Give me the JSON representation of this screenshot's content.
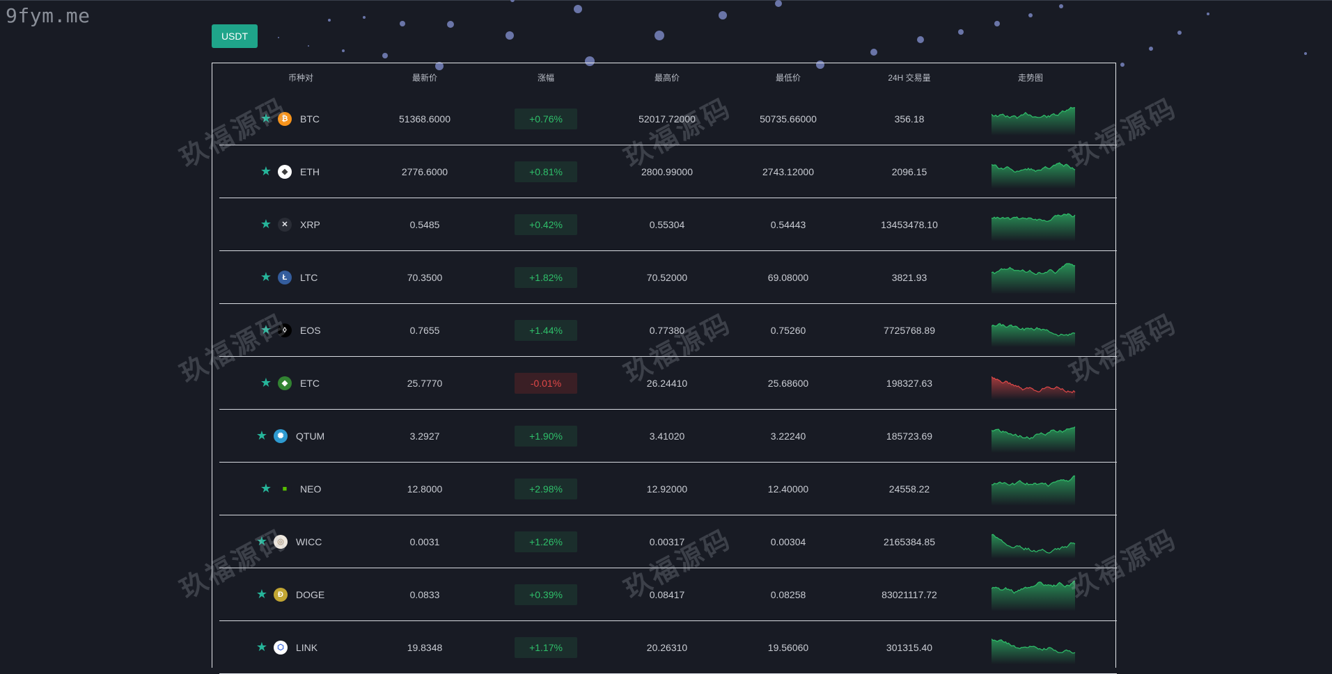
{
  "watermark_site": "9fym.me",
  "watermark_text": "玖福源码",
  "quote_button": "USDT",
  "colors": {
    "up": "#2fbf6a",
    "down": "#e04848",
    "accent": "#1fa58a"
  },
  "headers": [
    "币种对",
    "最新价",
    "涨幅",
    "最高价",
    "最低价",
    "24H 交易量",
    "走势图"
  ],
  "rows": [
    {
      "symbol": "BTC",
      "icon": "bitcoin-icon",
      "last": "51368.6000",
      "change": "+0.76%",
      "dir": "up",
      "high": "52017.72000",
      "low": "50735.66000",
      "volume": "356.18"
    },
    {
      "symbol": "ETH",
      "icon": "ethereum-icon",
      "last": "2776.6000",
      "change": "+0.81%",
      "dir": "up",
      "high": "2800.99000",
      "low": "2743.12000",
      "volume": "2096.15"
    },
    {
      "symbol": "XRP",
      "icon": "ripple-icon",
      "last": "0.5485",
      "change": "+0.42%",
      "dir": "up",
      "high": "0.55304",
      "low": "0.54443",
      "volume": "13453478.10"
    },
    {
      "symbol": "LTC",
      "icon": "litecoin-icon",
      "last": "70.3500",
      "change": "+1.82%",
      "dir": "up",
      "high": "70.52000",
      "low": "69.08000",
      "volume": "3821.93"
    },
    {
      "symbol": "EOS",
      "icon": "eos-icon",
      "last": "0.7655",
      "change": "+1.44%",
      "dir": "up",
      "high": "0.77380",
      "low": "0.75260",
      "volume": "7725768.89"
    },
    {
      "symbol": "ETC",
      "icon": "ethereum-classic-icon",
      "last": "25.7770",
      "change": "-0.01%",
      "dir": "down",
      "high": "26.24410",
      "low": "25.68600",
      "volume": "198327.63"
    },
    {
      "symbol": "QTUM",
      "icon": "qtum-icon",
      "last": "3.2927",
      "change": "+1.90%",
      "dir": "up",
      "high": "3.41020",
      "low": "3.22240",
      "volume": "185723.69"
    },
    {
      "symbol": "NEO",
      "icon": "neo-icon",
      "last": "12.8000",
      "change": "+2.98%",
      "dir": "up",
      "high": "12.92000",
      "low": "12.40000",
      "volume": "24558.22"
    },
    {
      "symbol": "WICC",
      "icon": "wicc-icon",
      "last": "0.0031",
      "change": "+1.26%",
      "dir": "up",
      "high": "0.00317",
      "low": "0.00304",
      "volume": "2165384.85"
    },
    {
      "symbol": "DOGE",
      "icon": "dogecoin-icon",
      "last": "0.0833",
      "change": "+0.39%",
      "dir": "up",
      "high": "0.08417",
      "low": "0.08258",
      "volume": "83021117.72"
    },
    {
      "symbol": "LINK",
      "icon": "chainlink-icon",
      "last": "19.8348",
      "change": "+1.17%",
      "dir": "up",
      "high": "20.26310",
      "low": "19.56060",
      "volume": "301315.40"
    }
  ]
}
